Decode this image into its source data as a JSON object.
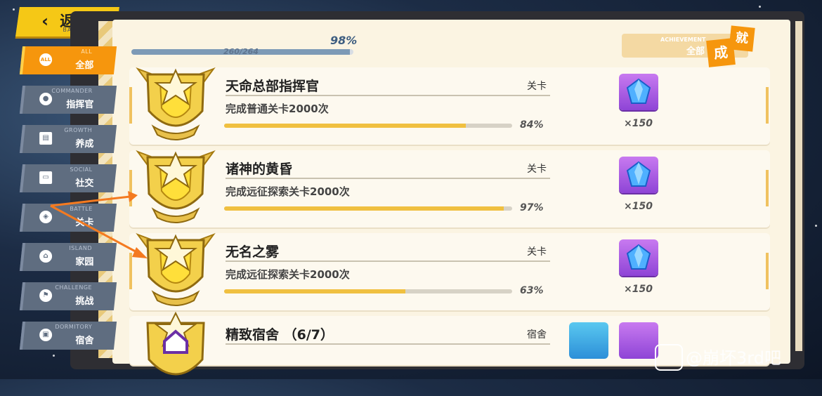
{
  "back": {
    "label": "返回",
    "sub": "BACK"
  },
  "sidebar": [
    {
      "en": "ALL",
      "zh": "全部",
      "icon": "ALL",
      "active": true
    },
    {
      "en": "COMMANDER",
      "zh": "指挥官",
      "icon": "person-icon"
    },
    {
      "en": "GROWTH",
      "zh": "养成",
      "icon": "book-icon"
    },
    {
      "en": "SOCIAL",
      "zh": "社交",
      "icon": "id-card-icon"
    },
    {
      "en": "BATTLE",
      "zh": "关卡",
      "icon": "target-icon"
    },
    {
      "en": "ISLAND",
      "zh": "家园",
      "icon": "home-icon"
    },
    {
      "en": "CHALLENGE",
      "zh": "挑战",
      "icon": "flag-icon"
    },
    {
      "en": "DORMITORY",
      "zh": "宿舍",
      "icon": "dorm-icon"
    }
  ],
  "overall": {
    "percent": "98%",
    "count": "260/264",
    "progress": 0.985
  },
  "achievement_badge": {
    "en": "ACHIEVEMENT",
    "zh": "全部",
    "char1": "成",
    "char2": "就"
  },
  "achievements": [
    {
      "title": "天命总部指挥官",
      "category": "关卡",
      "desc": "完成普通关卡2000次",
      "percent": "84%",
      "progress": 0.84,
      "reward_qty": "×150"
    },
    {
      "title": "诸神的黄昏",
      "category": "关卡",
      "desc": "完成远征探索关卡2000次",
      "percent": "97%",
      "progress": 0.97,
      "reward_qty": "×150"
    },
    {
      "title": "无名之雾",
      "category": "关卡",
      "desc": "完成远征探索关卡2000次",
      "percent": "63%",
      "progress": 0.63,
      "reward_qty": "×150"
    },
    {
      "title": "精致宿舍 （6/7）",
      "category": "宿舍",
      "desc": "",
      "percent": "",
      "progress": 0,
      "reward_qty": ""
    }
  ],
  "watermark": {
    "text": "@崩坏3rd吧"
  },
  "colors": {
    "accent": "#f6960d",
    "progress": "#f0c040",
    "tab": "#5f6d80",
    "reward": "#9b4fe0"
  }
}
